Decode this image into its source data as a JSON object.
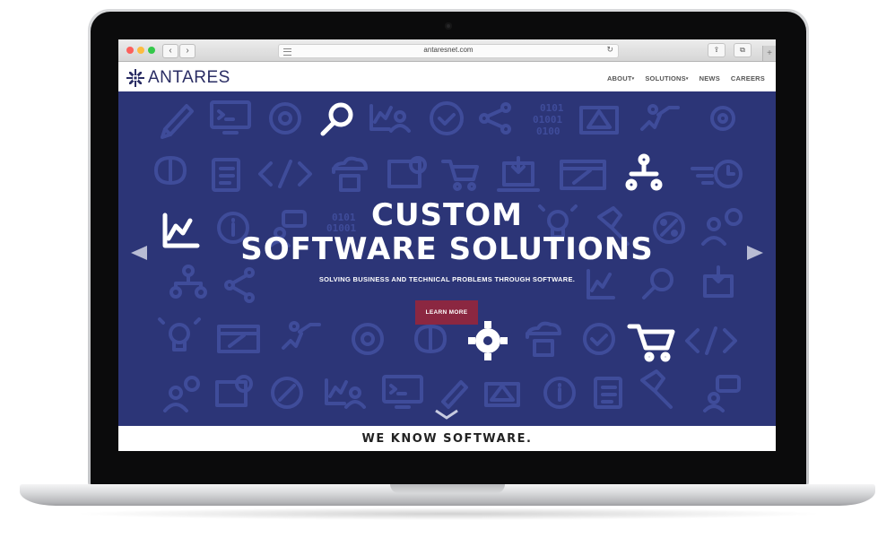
{
  "browser": {
    "url": "antaresnet.com",
    "back_label": "‹",
    "forward_label": "›",
    "reload_icon": "↻",
    "share_icon": "⇪",
    "tabs_icon": "⧉",
    "new_tab_icon": "+"
  },
  "site": {
    "logo_text": "ANTARES",
    "nav": {
      "about": "ABOUT",
      "solutions": "SOLUTIONS",
      "news": "NEWS",
      "careers": "CAREERS",
      "caret": "▾"
    },
    "hero": {
      "title_line1": "CUSTOM",
      "title_line2": "SOFTWARE SOLUTIONS",
      "subtitle": "SOLVING BUSINESS AND TECHNICAL PROBLEMS THROUGH SOFTWARE.",
      "cta": "LEARN MORE",
      "binary": "0101\n01001\n0100"
    },
    "tagline": "WE KNOW SOFTWARE."
  },
  "colors": {
    "hero_bg": "#2c3577",
    "icon_dim": "#3f4c9a",
    "cta_bg": "#8b2741",
    "brand": "#2a2d64"
  },
  "icons": [
    "pencil-icon",
    "terminal-icon",
    "gear-cycle-icon",
    "search-icon",
    "chart-person-icon",
    "refresh-icon",
    "share-icon",
    "binary-icon",
    "blueprint-icon",
    "runner-icon",
    "gear-icon",
    "brain-icon",
    "clipboard-icon",
    "code-icon",
    "cloud-save-icon",
    "certificate-icon",
    "cart-icon",
    "download-icon",
    "browser-edit-icon",
    "org-chart-icon",
    "timer-icon",
    "line-chart-icon",
    "info-icon",
    "chat-person-icon",
    "lightbulb-icon",
    "hammer-icon",
    "percent-icon",
    "person-clock-icon"
  ]
}
